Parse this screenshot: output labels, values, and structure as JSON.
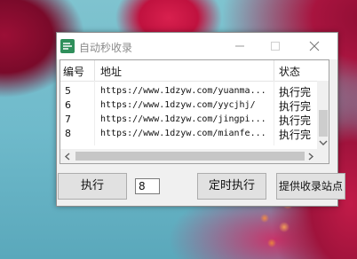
{
  "window": {
    "title": "自动秒收录"
  },
  "table": {
    "headers": [
      "编号",
      "地址",
      "状态"
    ],
    "rows": [
      {
        "no": "5",
        "url": "https://www.1dzyw.com/yuanma...",
        "status": "执行完"
      },
      {
        "no": "6",
        "url": "https://www.1dzyw.com/yycjhj/",
        "status": "执行完"
      },
      {
        "no": "7",
        "url": "https://www.1dzyw.com/jingpi...",
        "status": "执行完"
      },
      {
        "no": "8",
        "url": "https://www.1dzyw.com/mianfe...",
        "status": "执行完"
      }
    ]
  },
  "controls": {
    "run_label": "执行",
    "count_value": "8",
    "timer_label": "定时执行",
    "submit_label": "提供收录站点"
  },
  "colors": {
    "app_icon": "#2f8f5b",
    "window_bg": "#f0f0f0",
    "button_bg": "#e1e1e1"
  },
  "icons": [
    "app-icon",
    "minimize-icon",
    "maximize-icon",
    "close-icon",
    "scroll-left-icon",
    "scroll-right-icon",
    "scroll-down-icon"
  ]
}
